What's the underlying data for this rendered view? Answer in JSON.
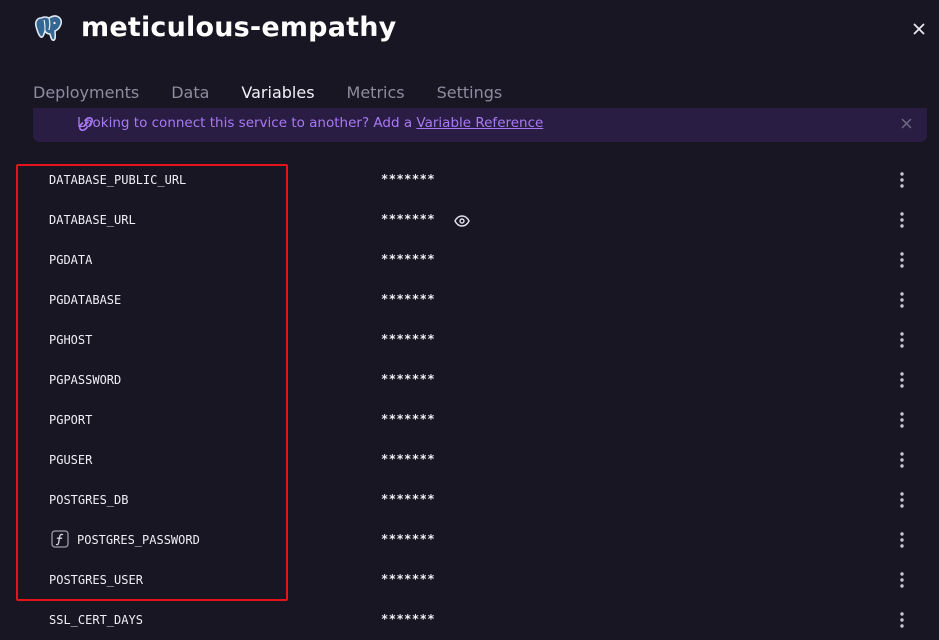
{
  "header": {
    "title": "meticulous-empathy",
    "logo_icon": "postgresql-elephant-icon",
    "close_icon": "close-icon"
  },
  "tabs": [
    {
      "label": "Deployments",
      "active": false
    },
    {
      "label": "Data",
      "active": false
    },
    {
      "label": "Variables",
      "active": true
    },
    {
      "label": "Metrics",
      "active": false
    },
    {
      "label": "Settings",
      "active": false
    }
  ],
  "banner": {
    "text": "Looking to connect this service to another? Add a ",
    "link": "Variable Reference",
    "icon": "link-icon",
    "close_icon": "close-icon",
    "color": "#a979f4"
  },
  "variables": [
    {
      "name": "DATABASE_PUBLIC_URL",
      "value": "*******"
    },
    {
      "name": "DATABASE_URL",
      "value": "*******",
      "reveal_icon": "eye-icon"
    },
    {
      "name": "PGDATA",
      "value": "*******"
    },
    {
      "name": "PGDATABASE",
      "value": "*******"
    },
    {
      "name": "PGHOST",
      "value": "*******"
    },
    {
      "name": "PGPASSWORD",
      "value": "*******"
    },
    {
      "name": "PGPORT",
      "value": "*******"
    },
    {
      "name": "PGUSER",
      "value": "*******"
    },
    {
      "name": "POSTGRES_DB",
      "value": "*******"
    },
    {
      "name": "POSTGRES_PASSWORD",
      "value": "*******",
      "function_icon": "function-icon"
    },
    {
      "name": "POSTGRES_USER",
      "value": "*******"
    },
    {
      "name": "SSL_CERT_DAYS",
      "value": "*******"
    }
  ],
  "row_menu_icon": "more-vertical-icon",
  "highlight_color": "#e4141a"
}
